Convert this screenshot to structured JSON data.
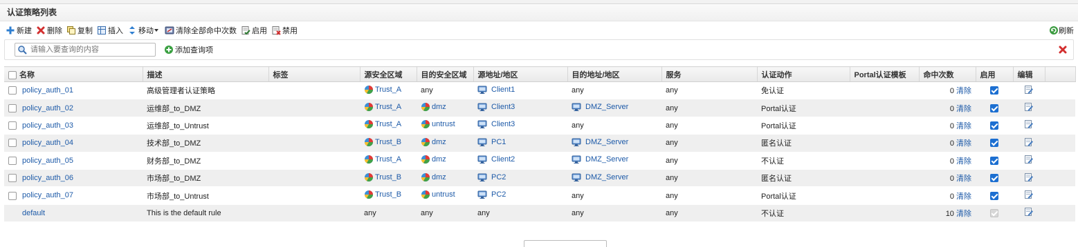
{
  "title": "认证策略列表",
  "toolbar": {
    "new": "新建",
    "delete": "删除",
    "copy": "复制",
    "insert": "插入",
    "move": "移动",
    "clear_all_hits": "清除全部命中次数",
    "enable": "启用",
    "disable": "禁用",
    "refresh": "刷新"
  },
  "search": {
    "placeholder": "请输入要查询的内容",
    "add_query": "添加查询项"
  },
  "columns": {
    "name": "名称",
    "desc": "描述",
    "tag": "标签",
    "src_zone": "源安全区域",
    "dst_zone": "目的安全区域",
    "src_addr": "源地址/地区",
    "dst_addr": "目的地址/地区",
    "service": "服务",
    "action": "认证动作",
    "portal_tpl": "Portal认证模板",
    "hits": "命中次数",
    "enabled": "启用",
    "edit": "编辑"
  },
  "clear_label": "清除",
  "rows": [
    {
      "name": "policy_auth_01",
      "desc": "高级管理者认证策略",
      "src_zone": "Trust_A",
      "dst_zone": "any",
      "src_addr": "Client1",
      "dst_addr": "any",
      "service": "any",
      "action": "免认证",
      "hits": "0"
    },
    {
      "name": "policy_auth_02",
      "desc": "运维部_to_DMZ",
      "src_zone": "Trust_A",
      "dst_zone": "dmz",
      "src_addr": "Client3",
      "dst_addr": "DMZ_Server",
      "service": "any",
      "action": "Portal认证",
      "hits": "0"
    },
    {
      "name": "policy_auth_03",
      "desc": "运维部_to_Untrust",
      "src_zone": "Trust_A",
      "dst_zone": "untrust",
      "src_addr": "Client3",
      "dst_addr": "any",
      "service": "any",
      "action": "Portal认证",
      "hits": "0"
    },
    {
      "name": "policy_auth_04",
      "desc": "技术部_to_DMZ",
      "src_zone": "Trust_B",
      "dst_zone": "dmz",
      "src_addr": "PC1",
      "dst_addr": "DMZ_Server",
      "service": "any",
      "action": "匿名认证",
      "hits": "0"
    },
    {
      "name": "policy_auth_05",
      "desc": "财务部_to_DMZ",
      "src_zone": "Trust_A",
      "dst_zone": "dmz",
      "src_addr": "Client2",
      "dst_addr": "DMZ_Server",
      "service": "any",
      "action": "不认证",
      "hits": "0"
    },
    {
      "name": "policy_auth_06",
      "desc": "市场部_to_DMZ",
      "src_zone": "Trust_B",
      "dst_zone": "dmz",
      "src_addr": "PC2",
      "dst_addr": "DMZ_Server",
      "service": "any",
      "action": "匿名认证",
      "hits": "0"
    },
    {
      "name": "policy_auth_07",
      "desc": "市场部_to_Untrust",
      "src_zone": "Trust_B",
      "dst_zone": "untrust",
      "src_addr": "PC2",
      "dst_addr": "any",
      "service": "any",
      "action": "Portal认证",
      "hits": "0"
    }
  ],
  "default_row": {
    "name": "default",
    "desc": "This is the default rule",
    "src_zone": "any",
    "dst_zone": "any",
    "src_addr": "any",
    "dst_addr": "any",
    "service": "any",
    "action": "不认证",
    "hits": "10"
  },
  "colors": {
    "link": "#1d5aa8",
    "check": "#1c6fd1",
    "delete": "#d32f2f",
    "add": "#3aa041"
  }
}
